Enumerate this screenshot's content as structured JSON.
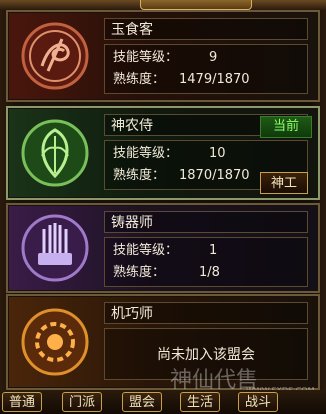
{
  "professions": [
    {
      "name": "玉食客",
      "level_label": "技能等级：",
      "level": "9",
      "prof_label": "熟练度：",
      "proficiency": "1479/1870"
    },
    {
      "name": "神农侍",
      "level_label": "技能等级：",
      "level": "10",
      "prof_label": "熟练度：",
      "proficiency": "1870/1870",
      "badge": "当前",
      "button": "神工"
    },
    {
      "name": "铸器师",
      "level_label": "技能等级：",
      "level": "1",
      "prof_label": "熟练度：",
      "proficiency": "1/8"
    },
    {
      "name": "机巧师",
      "message": "尚未加入该盟会"
    }
  ],
  "tabs": [
    "普通",
    "门派",
    "盟会",
    "生活",
    "战斗"
  ],
  "watermark": {
    "text": "神仙代售",
    "url": "WWW.SXDS.COM"
  },
  "colors": {
    "food": "#4a160c",
    "farm": "#1a3418",
    "forge": "#3a1c48",
    "craft": "#4a260a",
    "current": "#8dff6a"
  }
}
